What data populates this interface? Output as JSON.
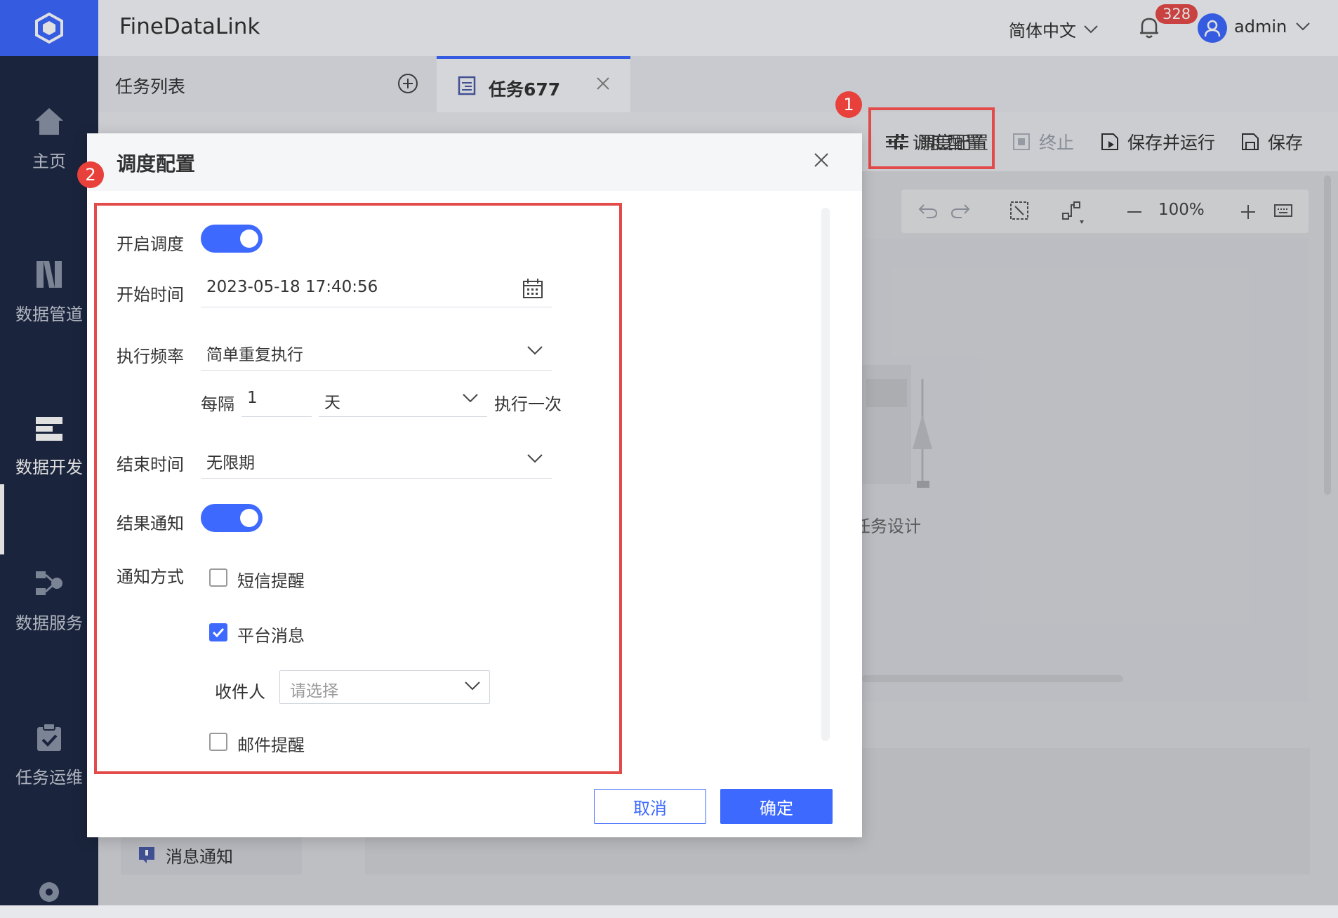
{
  "app": {
    "title": "FineDataLink"
  },
  "header": {
    "language": "简体中文",
    "notification_count": "328",
    "user": "admin"
  },
  "sidebar": {
    "items": [
      {
        "label": "主页",
        "icon": "home-icon"
      },
      {
        "label": "数据管道",
        "icon": "pipeline-icon"
      },
      {
        "label": "数据开发",
        "icon": "data-dev-icon",
        "active": true
      },
      {
        "label": "数据服务",
        "icon": "data-service-icon"
      },
      {
        "label": "任务运维",
        "icon": "task-ops-icon"
      }
    ]
  },
  "tabs": {
    "list_label": "任务列表",
    "active_tab": "任务677"
  },
  "toolbar": {
    "schedule": "调度配置",
    "stop": "终止",
    "save_run": "保存并运行",
    "save": "保存"
  },
  "canvas": {
    "zoom": "100%",
    "empty_hint": "任务设计"
  },
  "lower": {
    "message_item": "消息通知"
  },
  "annotations": {
    "step1": "1",
    "step2": "2"
  },
  "modal": {
    "title": "调度配置",
    "enable_schedule_label": "开启调度",
    "enable_schedule": true,
    "start_time_label": "开始时间",
    "start_time": "2023-05-18 17:40:56",
    "frequency_label": "执行频率",
    "frequency": "简单重复执行",
    "every_label": "每隔",
    "interval_value": "1",
    "interval_unit": "天",
    "every_suffix": "执行一次",
    "end_time_label": "结束时间",
    "end_time": "无限期",
    "notify_label": "结果通知",
    "notify": true,
    "notify_method_label": "通知方式",
    "sms_label": "短信提醒",
    "sms_checked": false,
    "platform_label": "平台消息",
    "platform_checked": true,
    "recipient_label": "收件人",
    "recipient_placeholder": "请选择",
    "email_label": "邮件提醒",
    "email_checked": false,
    "cancel": "取消",
    "confirm": "确定"
  },
  "colors": {
    "accent": "#3d69ff",
    "sidebar": "#1e2a45",
    "highlight": "#e34a4a"
  }
}
